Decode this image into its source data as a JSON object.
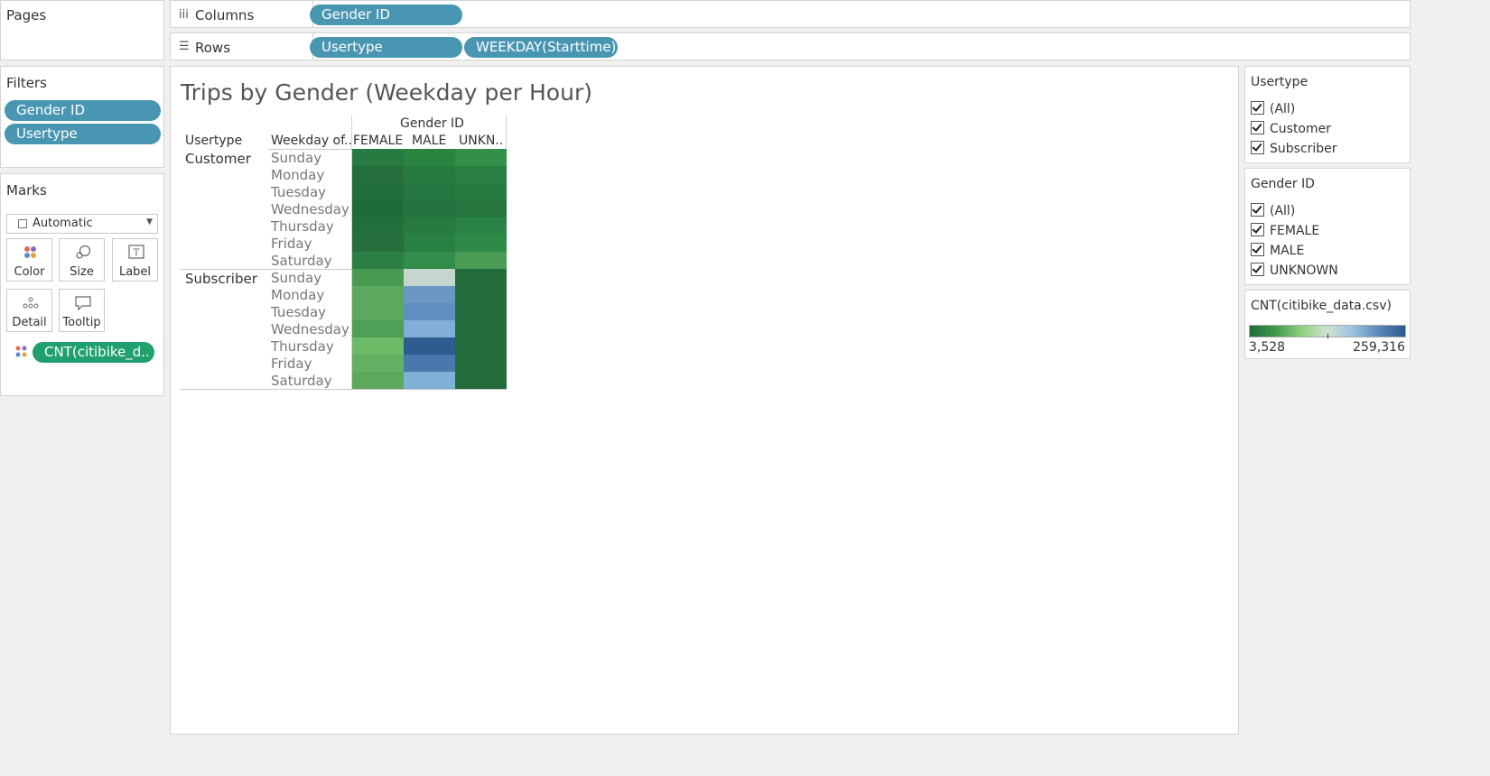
{
  "pages": {
    "title": "Pages"
  },
  "columns_shelf": {
    "label": "Columns",
    "pills": [
      "Gender ID"
    ]
  },
  "rows_shelf": {
    "label": "Rows",
    "pills": [
      "Usertype",
      "WEEKDAY(Starttime)"
    ]
  },
  "filters": {
    "title": "Filters",
    "pills": [
      "Gender ID",
      "Usertype"
    ]
  },
  "marks": {
    "title": "Marks",
    "mark_type": "Automatic",
    "buttons": [
      "Color",
      "Size",
      "Label",
      "Detail",
      "Tooltip"
    ],
    "field_pill": "CNT(citibike_d.."
  },
  "viz": {
    "title": "Trips by Gender (Weekday per Hour)",
    "column_header": "Gender ID",
    "row_header_1": "Usertype",
    "row_header_2": "Weekday of..",
    "columns": [
      "FEMALE",
      "MALE",
      "UNKN.."
    ],
    "groups": [
      {
        "name": "Customer",
        "days": [
          "Sunday",
          "Monday",
          "Tuesday",
          "Wednesday",
          "Thursday",
          "Friday",
          "Saturday"
        ],
        "colors": [
          [
            "#277a42",
            "#2a843f",
            "#338f48"
          ],
          [
            "#236e3c",
            "#277a40",
            "#297f41"
          ],
          [
            "#216d3b",
            "#257741",
            "#277a40"
          ],
          [
            "#1f6a39",
            "#247340",
            "#24763e"
          ],
          [
            "#226f3c",
            "#277b41",
            "#2b8245"
          ],
          [
            "#246f3c",
            "#288045",
            "#2f8a48"
          ],
          [
            "#2c7f42",
            "#348c4a",
            "#4b9c55"
          ]
        ]
      },
      {
        "name": "Subscriber",
        "days": [
          "Sunday",
          "Monday",
          "Tuesday",
          "Wednesday",
          "Thursday",
          "Friday",
          "Saturday"
        ],
        "colors": [
          [
            "#4a9a54",
            "#c6d6cf",
            "#236b3b"
          ],
          [
            "#5aa95e",
            "#6a98c3",
            "#236b3b"
          ],
          [
            "#5aa95e",
            "#5e8fc0",
            "#236b3b"
          ],
          [
            "#4f9f58",
            "#82afd6",
            "#236b3b"
          ],
          [
            "#6cbb66",
            "#2e5c8e",
            "#236b3b"
          ],
          [
            "#62b162",
            "#4a78ac",
            "#236b3b"
          ],
          [
            "#5ca95e",
            "#7fb0d8",
            "#236b3b"
          ]
        ]
      }
    ]
  },
  "usertype_filter": {
    "title": "Usertype",
    "options": [
      "(All)",
      "Customer",
      "Subscriber"
    ]
  },
  "gender_filter": {
    "title": "Gender ID",
    "options": [
      "(All)",
      "FEMALE",
      "MALE",
      "UNKNOWN"
    ]
  },
  "legend": {
    "title": "CNT(citibike_data.csv)",
    "min": "3,528",
    "max": "259,316",
    "colors": [
      "#1f6b3a",
      "#3f9a4c",
      "#8fd07f",
      "#cfe1d3",
      "#9ac0de",
      "#5a86b8",
      "#2b5b8f"
    ]
  }
}
